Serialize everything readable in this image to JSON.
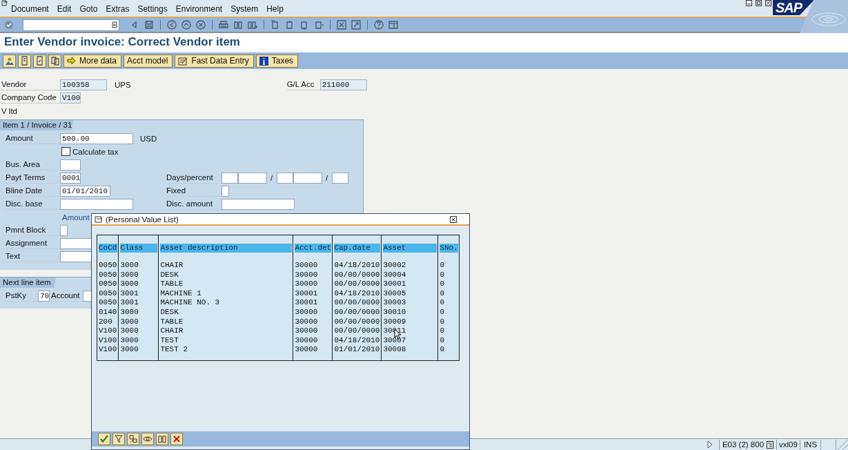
{
  "window": {
    "logo": "SAP"
  },
  "menu": [
    "Document",
    "Edit",
    "Goto",
    "Extras",
    "Settings",
    "Environment",
    "System",
    "Help"
  ],
  "title": "Enter Vendor invoice: Correct Vendor item",
  "app_toolbar": [
    {
      "label": "More data",
      "kind": "arrow"
    },
    {
      "label": "Acct model",
      "kind": "text"
    },
    {
      "label": "Fast Data Entry",
      "kind": "form"
    },
    {
      "label": "Taxes",
      "kind": "info"
    }
  ],
  "header": {
    "vendor": {
      "label": "Vendor",
      "value": "100358",
      "name": "UPS"
    },
    "gl_acc": {
      "label": "G/L Acc",
      "value": "211000"
    },
    "company_code": {
      "label": "Company Code",
      "value": "V100"
    },
    "company_name": "V ltd"
  },
  "item_panel": {
    "tab": "Item 1 / Invoice / 31",
    "amount": {
      "label": "Amount",
      "value": "500.00",
      "currency": "USD"
    },
    "calculate_tax": {
      "label": "Calculate tax",
      "checked": false
    },
    "bus_area": {
      "label": "Bus. Area"
    },
    "payt_terms": {
      "label": "Payt Terms",
      "value": "0001"
    },
    "bline_date": {
      "label": "Bline Date",
      "value": "01/01/2010"
    },
    "disc_base": {
      "label": "Disc. base"
    },
    "amount_group": "Amount",
    "pmnt_block": {
      "label": "Pmnt Block"
    },
    "assignment": {
      "label": "Assignment"
    },
    "text": {
      "label": "Text"
    },
    "days_percent": {
      "label": "Days/percent",
      "separators": [
        "/",
        "/"
      ]
    },
    "fixed": {
      "label": "Fixed"
    },
    "disc_amount": {
      "label": "Disc. amount"
    }
  },
  "next_panel": {
    "tab": "Next line item",
    "pstky": {
      "label": "PstKy",
      "value": "70"
    },
    "account": {
      "label": "Account"
    }
  },
  "popup": {
    "title": "(Personal Value List)",
    "columns": [
      "CoCd",
      "Class",
      "Asset description",
      "Acct.det",
      "Cap.date",
      "Asset",
      "SNo."
    ],
    "rows": [
      [
        "0050",
        "3000",
        "CHAIR",
        "30000",
        "04/18/2010",
        "30002",
        "0"
      ],
      [
        "0050",
        "3000",
        "DESK",
        "30000",
        "00/00/0000",
        "30004",
        "0"
      ],
      [
        "0050",
        "3000",
        "TABLE",
        "30000",
        "00/00/0000",
        "30001",
        "0"
      ],
      [
        "0050",
        "3001",
        "MACHINE 1",
        "30001",
        "04/18/2010",
        "30005",
        "0"
      ],
      [
        "0050",
        "3001",
        "MACHINE NO. 3",
        "30001",
        "00/00/0000",
        "30003",
        "0"
      ],
      [
        "0140",
        "3000",
        "DESK",
        "30000",
        "00/00/0000",
        "30010",
        "0"
      ],
      [
        "200",
        "3000",
        "TABLE",
        "30000",
        "00/00/0000",
        "30009",
        "0"
      ],
      [
        "V100",
        "3000",
        "CHAIR",
        "30000",
        "00/00/0000",
        "30011",
        "0"
      ],
      [
        "V100",
        "3000",
        "TEST",
        "30000",
        "04/18/2010",
        "30007",
        "0"
      ],
      [
        "V100",
        "3000",
        "TEST 2",
        "30000",
        "01/01/2010",
        "30008",
        "0"
      ]
    ]
  },
  "status_bar": {
    "system": "E03 (2) 800",
    "server": "vxl09",
    "mode": "INS"
  }
}
